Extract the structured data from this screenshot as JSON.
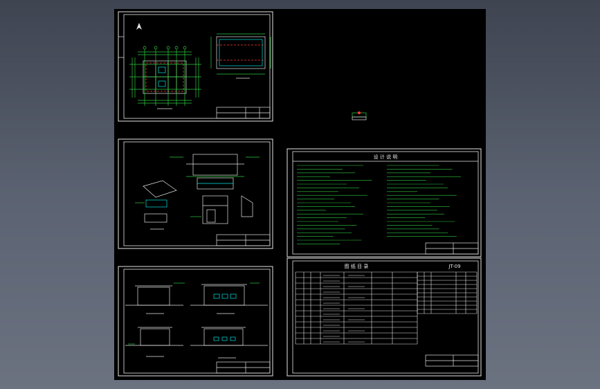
{
  "viewer": {
    "background_color": "#5b6271",
    "canvas_color": "#000000"
  },
  "sheets": {
    "notes_title": "设 计 说 明",
    "schedule_title": "图 纸 目 录",
    "schedule_code": "JT-09"
  },
  "colors": {
    "line_white": "#e6e6e6",
    "line_green": "#2ecc40",
    "line_cyan": "#00e5e5",
    "line_red": "#ff3b3b",
    "line_yellow": "#f2e600",
    "line_magenta": "#e040fb"
  }
}
